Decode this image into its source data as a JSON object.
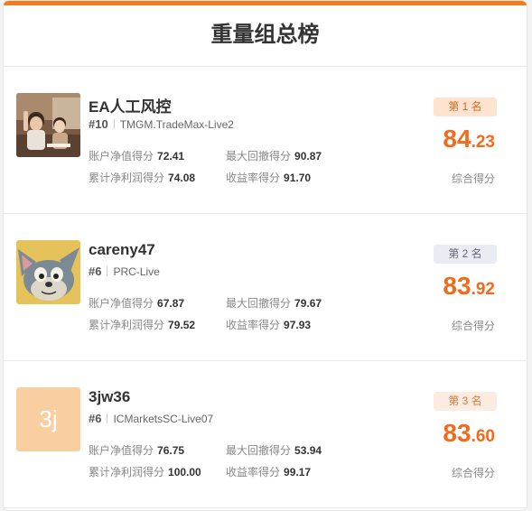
{
  "page": {
    "title": "重量组总榜",
    "accent_color": "#f57a1f"
  },
  "entries": [
    {
      "name": "EA人工风控",
      "number": "#10",
      "server": "TMGM.TradeMax-Live2",
      "labels": {
        "net_value": "账户净值得分",
        "drawdown": "最大回撤得分",
        "profit": "累计净利润得分",
        "return": "收益率得分"
      },
      "net_value": "72.41",
      "drawdown": "90.87",
      "profit": "74.08",
      "return": "91.70",
      "rank": "第 1 名",
      "score_int": "84",
      "score_frac": ".23",
      "score_label": "综合得分",
      "avatar": "photo-children"
    },
    {
      "name": "careny47",
      "number": "#6",
      "server": "PRC-Live",
      "labels": {
        "net_value": "账户净值得分",
        "drawdown": "最大回撤得分",
        "profit": "累计净利润得分",
        "return": "收益率得分"
      },
      "net_value": "67.87",
      "drawdown": "79.67",
      "profit": "79.52",
      "return": "97.93",
      "rank": "第 2 名",
      "score_int": "83",
      "score_frac": ".92",
      "score_label": "综合得分",
      "avatar": "cartoon-cat"
    },
    {
      "name": "3jw36",
      "number": "#6",
      "server": "ICMarketsSC-Live07",
      "labels": {
        "net_value": "账户净值得分",
        "drawdown": "最大回撤得分",
        "profit": "累计净利润得分",
        "return": "收益率得分"
      },
      "net_value": "76.75",
      "drawdown": "53.94",
      "profit": "100.00",
      "return": "99.17",
      "rank": "第 3 名",
      "score_int": "83",
      "score_frac": ".60",
      "score_label": "综合得分",
      "avatar_letter": "3j"
    }
  ]
}
